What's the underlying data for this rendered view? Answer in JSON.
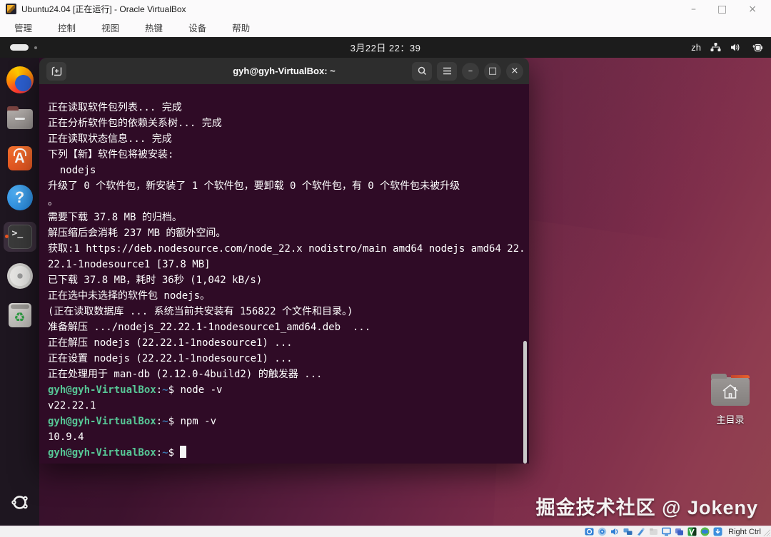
{
  "vbox": {
    "title": "Ubuntu24.04 [正在运行] - Oracle VirtualBox",
    "menus": [
      "管理",
      "控制",
      "视图",
      "热键",
      "设备",
      "帮助"
    ],
    "window_controls": {
      "minimize": "–",
      "maximize": "□",
      "close": "×"
    },
    "statusbar": {
      "icons": [
        "hard-disks",
        "optical-drives",
        "audio",
        "network",
        "usb",
        "shared-folders",
        "display",
        "recording",
        "features",
        "session-info",
        "host-key-state"
      ],
      "host_key": "Right Ctrl"
    }
  },
  "topbar": {
    "datetime": "3月22日 22：39",
    "input_method": "zh",
    "tray_icons": [
      "network-icon",
      "volume-icon",
      "battery-icon"
    ]
  },
  "dock": {
    "items": [
      {
        "name": "firefox",
        "active": false
      },
      {
        "name": "files",
        "active": false
      },
      {
        "name": "app-center",
        "active": false
      },
      {
        "name": "help",
        "active": false
      },
      {
        "name": "terminal",
        "active": true
      },
      {
        "name": "disc-burner",
        "active": false
      },
      {
        "name": "trash",
        "active": false
      },
      {
        "name": "show-apps",
        "active": false
      }
    ],
    "appcenter_letter": "A",
    "help_glyph": "?",
    "terminal_glyph": ">_",
    "trash_glyph": "♻"
  },
  "terminal": {
    "title": "gyh@gyh-VirtualBox: ~",
    "header_controls": {
      "minimize": "–",
      "maximize": "□",
      "close": "×"
    },
    "lines": [
      [
        {
          "t": "正在读取软件包列表... 完成",
          "c": "fg"
        }
      ],
      [
        {
          "t": "正在分析软件包的依赖关系树... 完成",
          "c": "fg"
        }
      ],
      [
        {
          "t": "正在读取状态信息... 完成",
          "c": "fg"
        }
      ],
      [
        {
          "t": "下列【新】软件包将被安装:",
          "c": "fg"
        }
      ],
      [
        {
          "t": "  nodejs",
          "c": "fg"
        }
      ],
      [
        {
          "t": "升级了 0 个软件包，新安装了 1 个软件包，要卸载 0 个软件包，有 0 个软件包未被升级",
          "c": "fg"
        }
      ],
      [
        {
          "t": "。",
          "c": "fg"
        }
      ],
      [
        {
          "t": "需要下载 37.8 MB 的归档。",
          "c": "fg"
        }
      ],
      [
        {
          "t": "解压缩后会消耗 237 MB 的额外空间。",
          "c": "fg"
        }
      ],
      [
        {
          "t": "获取:1 https://deb.nodesource.com/node_22.x nodistro/main amd64 nodejs amd64 22.",
          "c": "fg"
        }
      ],
      [
        {
          "t": "22.1-1nodesource1 [37.8 MB]",
          "c": "fg"
        }
      ],
      [
        {
          "t": "已下载 37.8 MB，耗时 36秒 (1,042 kB/s)",
          "c": "fg"
        }
      ],
      [
        {
          "t": "正在选中未选择的软件包 nodejs。",
          "c": "fg"
        }
      ],
      [
        {
          "t": "(正在读取数据库 ... 系统当前共安装有 156822 个文件和目录。)",
          "c": "fg"
        }
      ],
      [
        {
          "t": "准备解压 .../nodejs_22.22.1-1nodesource1_amd64.deb  ...",
          "c": "fg"
        }
      ],
      [
        {
          "t": "正在解压 nodejs (22.22.1-1nodesource1) ...",
          "c": "fg"
        }
      ],
      [
        {
          "t": "正在设置 nodejs (22.22.1-1nodesource1) ...",
          "c": "fg"
        }
      ],
      [
        {
          "t": "正在处理用于 man-db (2.12.0-4build2) 的触发器 ...",
          "c": "fg"
        }
      ],
      [
        {
          "t": "gyh@gyh-VirtualBox",
          "c": "green"
        },
        {
          "t": ":",
          "c": "fg"
        },
        {
          "t": "~",
          "c": "blue"
        },
        {
          "t": "$ ",
          "c": "fg"
        },
        {
          "t": "node -v",
          "c": "fg"
        }
      ],
      [
        {
          "t": "v22.22.1",
          "c": "fg"
        }
      ],
      [
        {
          "t": "gyh@gyh-VirtualBox",
          "c": "green"
        },
        {
          "t": ":",
          "c": "fg"
        },
        {
          "t": "~",
          "c": "blue"
        },
        {
          "t": "$ ",
          "c": "fg"
        },
        {
          "t": "npm -v",
          "c": "fg"
        }
      ],
      [
        {
          "t": "10.9.4",
          "c": "fg"
        }
      ],
      [
        {
          "t": "gyh@gyh-VirtualBox",
          "c": "green"
        },
        {
          "t": ":",
          "c": "fg"
        },
        {
          "t": "~",
          "c": "blue"
        },
        {
          "t": "$ ",
          "c": "fg"
        },
        {
          "t": "",
          "c": "cursor"
        }
      ]
    ]
  },
  "desktop": {
    "home_label": "主目录",
    "watermark": "掘金技术社区 @ Jokeny"
  },
  "colors": {
    "terminal_bg": "#2f0b26",
    "terminal_header": "#2d2d2d",
    "prompt_green": "#57c796",
    "prompt_blue": "#3b77b0",
    "topbar_bg": "#1c1c1c",
    "dock_bg": "#1e1620",
    "accent_orange": "#e95420"
  }
}
